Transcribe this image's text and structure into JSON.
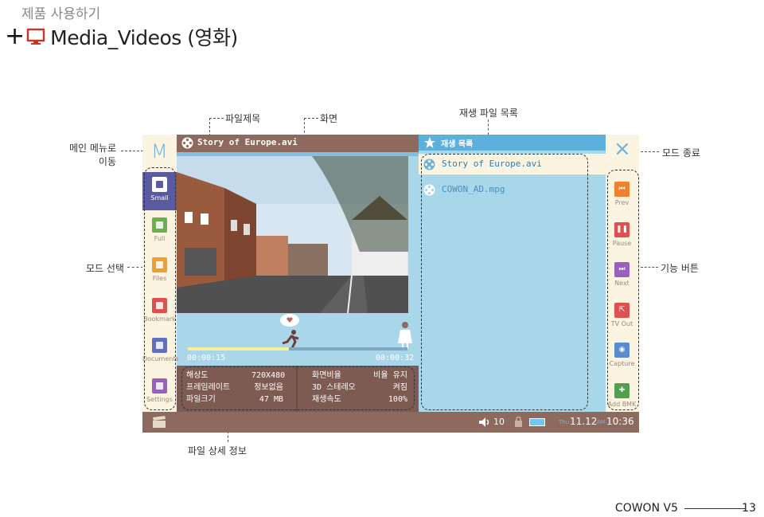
{
  "header": {
    "section": "제품 사용하기",
    "title": "Media_Videos (영화)"
  },
  "annotations": {
    "file_title": "파일제목",
    "screen": "화면",
    "playlist": "재생 파일 목록",
    "main_menu": "메인 메뉴로\n이동",
    "mode_exit": "모드 종료",
    "mode_select": "모드 선택",
    "function_buttons": "기능 버튼",
    "file_details": "파일 상세 정보"
  },
  "player": {
    "file_title": "Story of Europe.avi",
    "left_top_logo": "M",
    "close_glyph": "×",
    "elapsed": "00:00:15",
    "total": "00:00:32",
    "progress": 0.46,
    "info": [
      {
        "label": "해상도",
        "value": "720X480"
      },
      {
        "label": "프레임레이트",
        "value": "정보없음"
      },
      {
        "label": "파일크기",
        "value": "47 MB"
      }
    ],
    "info2": [
      {
        "label": "화면비율",
        "value": "비율 유지"
      },
      {
        "label": "3D 스테레오",
        "value": "켜짐"
      },
      {
        "label": "재생속도",
        "value": "100%"
      }
    ],
    "playlist_title": "재생 목록",
    "playlist": [
      "Story of Europe.avi",
      "COWON_AD.mpg"
    ],
    "mode_buttons": [
      {
        "label": "Small",
        "color": "#5a5aa0"
      },
      {
        "label": "Full",
        "color": "#6ab04c"
      },
      {
        "label": "Files",
        "color": "#f0a030"
      },
      {
        "label": "Bookmark",
        "color": "#e05050"
      },
      {
        "label": "Documents",
        "color": "#6070c0"
      },
      {
        "label": "Settings",
        "color": "#9a60c0"
      }
    ],
    "function_buttons": [
      {
        "label": "Prev",
        "color": "#f08030"
      },
      {
        "label": "Pause",
        "color": "#e05050"
      },
      {
        "label": "Next",
        "color": "#9a60c0"
      },
      {
        "label": "TV Out",
        "color": "#e05050"
      },
      {
        "label": "Capture",
        "color": "#5a8ad0"
      },
      {
        "label": "Add BMK",
        "color": "#50a050"
      }
    ],
    "status": {
      "volume": "10",
      "day": "Thu",
      "date": "11.12",
      "ampm": "AM",
      "time": "10:36"
    }
  },
  "footer": {
    "brand": "COWON V5",
    "page": "13"
  }
}
